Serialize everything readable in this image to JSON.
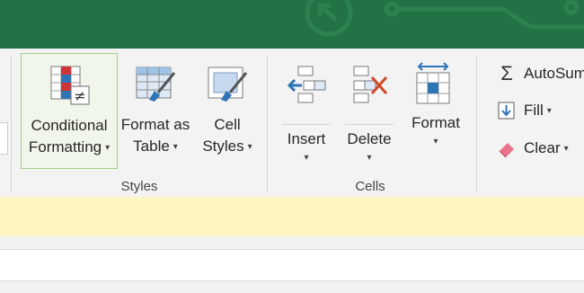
{
  "ribbon": {
    "styles_group": {
      "label": "Styles",
      "conditional_formatting": {
        "line1": "Conditional",
        "line2": "Formatting"
      },
      "format_as_table": {
        "line1": "Format as",
        "line2": "Table"
      },
      "cell_styles": {
        "line1": "Cell",
        "line2": "Styles"
      }
    },
    "cells_group": {
      "label": "Cells",
      "insert": "Insert",
      "delete": "Delete",
      "format": "Format"
    },
    "editing_group": {
      "autosum": "AutoSum",
      "fill": "Fill",
      "clear": "Clear"
    }
  },
  "colors": {
    "title_bar": "#217346",
    "ribbon_bg": "#f3f3f3",
    "selected_button_border": "#a3cf87",
    "formula_bar_bg": "#fdf6c3",
    "accent_blue": "#2e75b6",
    "accent_red": "#d13438"
  }
}
